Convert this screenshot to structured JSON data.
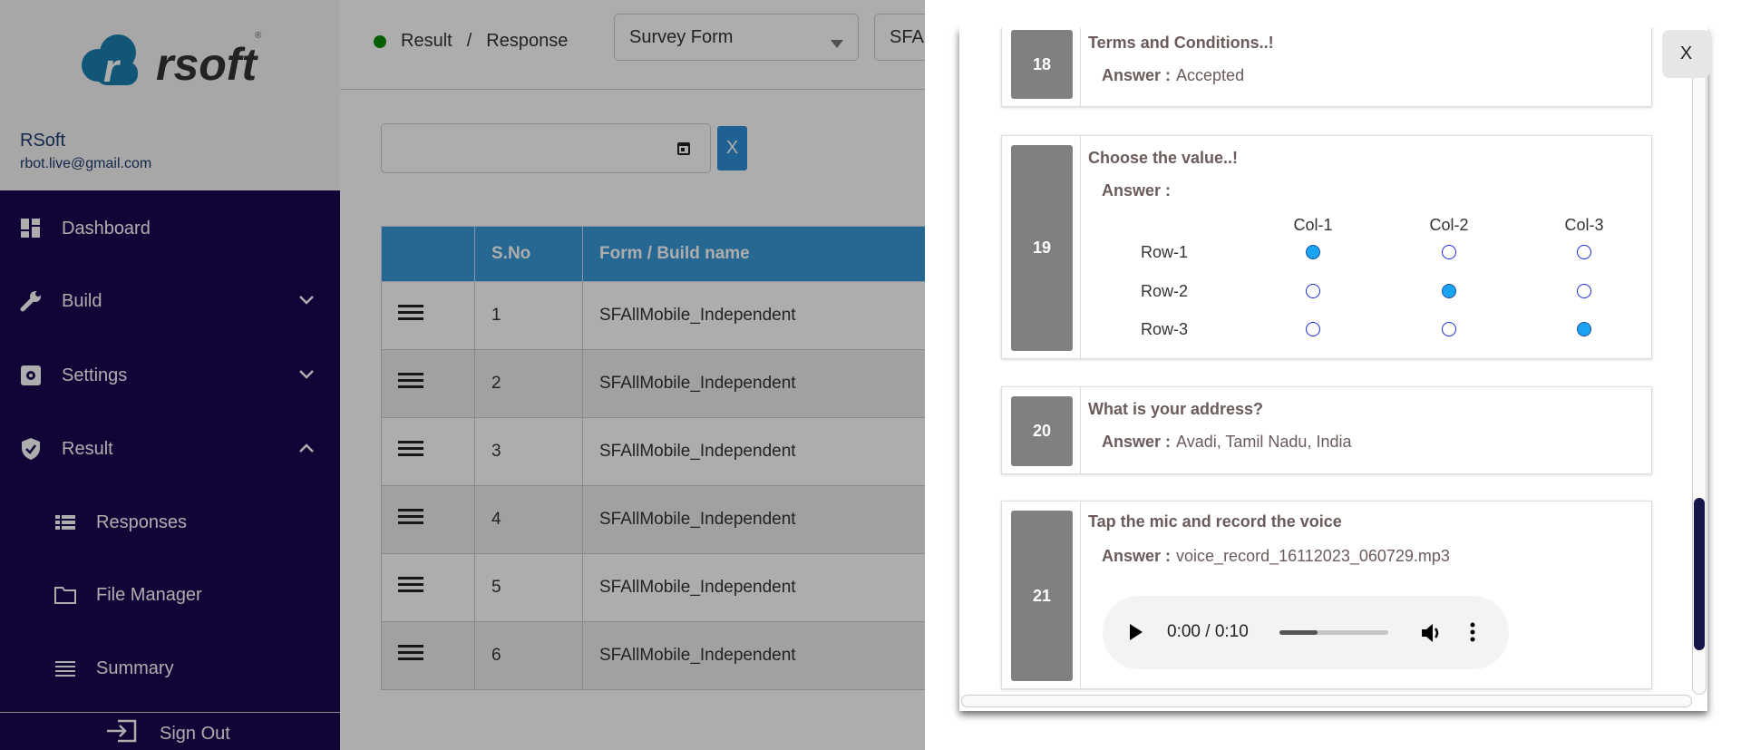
{
  "brand": {
    "logo_text": "rsoft",
    "logo_letter": "r"
  },
  "user": {
    "name": "RSoft",
    "email": "rbot.live@gmail.com"
  },
  "sidebar": {
    "items": [
      {
        "label": "Dashboard",
        "icon": "dashboard-icon"
      },
      {
        "label": "Build",
        "icon": "wrench-icon"
      },
      {
        "label": "Settings",
        "icon": "settings-icon"
      },
      {
        "label": "Result",
        "icon": "shield-icon"
      },
      {
        "label": "Responses",
        "icon": "list-icon"
      },
      {
        "label": "File Manager",
        "icon": "folder-icon"
      },
      {
        "label": "Summary",
        "icon": "lines-icon"
      }
    ],
    "signout": "Sign Out"
  },
  "header": {
    "breadcrumb": [
      "Result",
      "/",
      "Response"
    ],
    "form_select": "Survey Form",
    "build_select": "SFA"
  },
  "filter": {
    "date_value": "",
    "clear_label": "X"
  },
  "table": {
    "headers": [
      "",
      "S.No",
      "Form / Build name"
    ],
    "rows": [
      {
        "sno": "1",
        "name": "SFAllMobile_Independent"
      },
      {
        "sno": "2",
        "name": "SFAllMobile_Independent"
      },
      {
        "sno": "3",
        "name": "SFAllMobile_Independent"
      },
      {
        "sno": "4",
        "name": "SFAllMobile_Independent"
      },
      {
        "sno": "5",
        "name": "SFAllMobile_Independent"
      },
      {
        "sno": "6",
        "name": "SFAllMobile_Independent"
      }
    ]
  },
  "panel": {
    "close_label": "X",
    "answer_label": "Answer :",
    "questions": [
      {
        "num": "18",
        "question": "Terms and Conditions..!",
        "answer": "Accepted"
      },
      {
        "num": "19",
        "question": "Choose the value..!",
        "answer": "",
        "grid": {
          "cols": [
            "Col-1",
            "Col-2",
            "Col-3"
          ],
          "rows": [
            "Row-1",
            "Row-2",
            "Row-3"
          ],
          "selected": [
            0,
            1,
            2
          ]
        }
      },
      {
        "num": "20",
        "question": "What is your address?",
        "answer": "Avadi, Tamil Nadu, India"
      },
      {
        "num": "21",
        "question": "Tap the mic and record the voice",
        "answer": "voice_record_16112023_060729.mp3",
        "audio": {
          "time": "0:00 / 0:10",
          "progress": 0.35
        }
      }
    ]
  }
}
